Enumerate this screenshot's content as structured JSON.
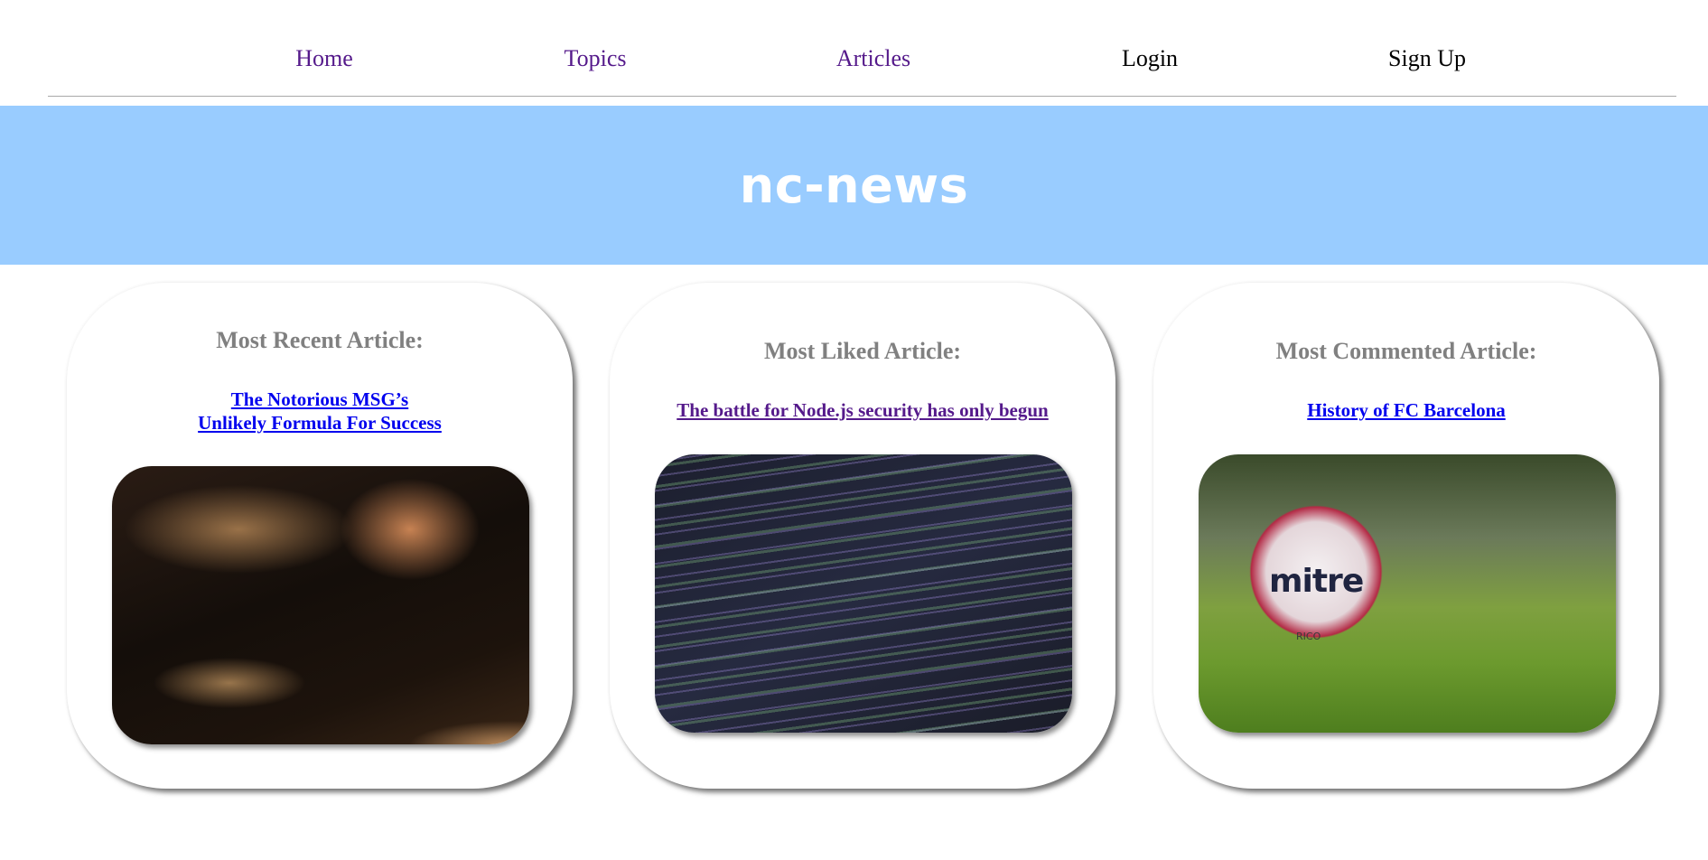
{
  "nav": {
    "items": [
      {
        "label": "Home"
      },
      {
        "label": "Topics"
      },
      {
        "label": "Articles"
      },
      {
        "label": "Login"
      },
      {
        "label": "Sign Up"
      }
    ]
  },
  "banner": {
    "title": "nc-news"
  },
  "cards": [
    {
      "heading": "Most Recent Article:",
      "article_title_line1": "The Notorious MSG’s",
      "article_title_line2": "Unlikely Formula For Success",
      "image": "cooking-photo"
    },
    {
      "heading": "Most Liked Article:",
      "article_title": "The battle for Node.js security has only begun",
      "image": "code-screen-photo"
    },
    {
      "heading": "Most Commented Article:",
      "article_title": "History of FC Barcelona",
      "image": "football-photo",
      "image_text": {
        "brand": "mitre",
        "model": "RICO"
      }
    }
  ],
  "colors": {
    "banner": "#99ccff",
    "visited_link": "#551a8b",
    "link": "#0000ee",
    "heading": "#808080"
  }
}
